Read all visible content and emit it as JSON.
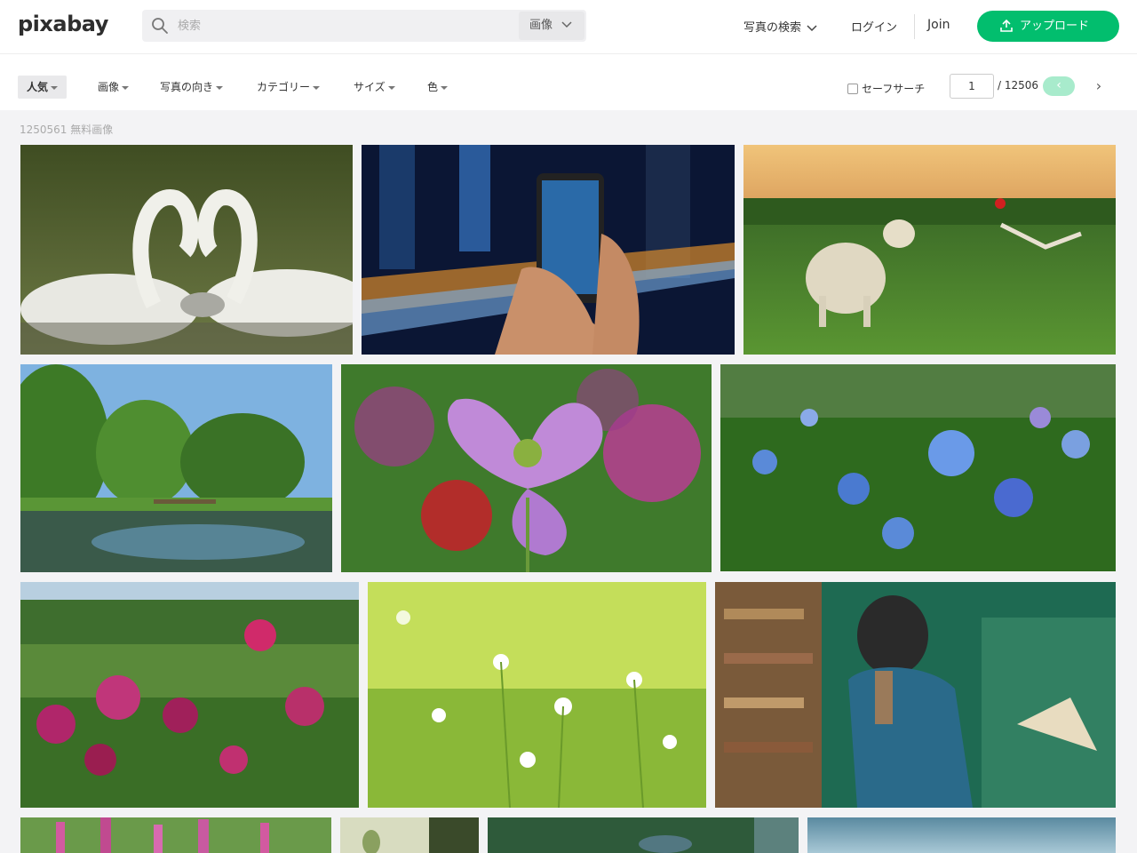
{
  "header": {
    "logo": "pixabay",
    "search_placeholder": "検索",
    "search_type": "画像",
    "explore": "写真の検索",
    "login": "ログイン",
    "join": "Join",
    "upload": "アップロード"
  },
  "filters": {
    "popular": "人気",
    "images": "画像",
    "orientation": "写真の向き",
    "category": "カテゴリー",
    "size": "サイズ",
    "color": "色",
    "safesearch": "セーフサーチ"
  },
  "pagination": {
    "current": "1",
    "total": "/ 12506",
    "prev": "‹",
    "next": "›"
  },
  "results": {
    "count": "1250561 無料画像"
  },
  "images": [
    {
      "name": "swans",
      "colors": [
        "#4c5a2a",
        "#d9d9d4"
      ]
    },
    {
      "name": "smartphone-city-night",
      "colors": [
        "#0d1a3a",
        "#d98a2b"
      ]
    },
    {
      "name": "lamb-meadow",
      "colors": [
        "#e7b56a",
        "#4f8a2e"
      ]
    },
    {
      "name": "pond-trees",
      "colors": [
        "#6fa6d8",
        "#2f6a24"
      ]
    },
    {
      "name": "purple-poppy",
      "colors": [
        "#3e7a2a",
        "#b86fd0"
      ]
    },
    {
      "name": "blue-nigella-flowers",
      "colors": [
        "#2f6a21",
        "#5b8ad8"
      ]
    },
    {
      "name": "pink-poppy-field",
      "colors": [
        "#3d6e2f",
        "#b0266a"
      ]
    },
    {
      "name": "daisy-meadow",
      "colors": [
        "#b6d64a",
        "#7aa82f"
      ]
    },
    {
      "name": "woman-books",
      "colors": [
        "#1f7a5a",
        "#7a5a3a"
      ]
    },
    {
      "name": "pink-lupines",
      "colors": [
        "#5a8a3a",
        "#d25aa0"
      ]
    },
    {
      "name": "white-flower-bud",
      "colors": [
        "#cfd8b6",
        "#3a4a2a"
      ]
    },
    {
      "name": "green-blur",
      "colors": [
        "#2e5a3a",
        "#4b7a5a"
      ]
    },
    {
      "name": "blue-sky-sea",
      "colors": [
        "#6a9ab0",
        "#9ec2d0"
      ]
    }
  ]
}
